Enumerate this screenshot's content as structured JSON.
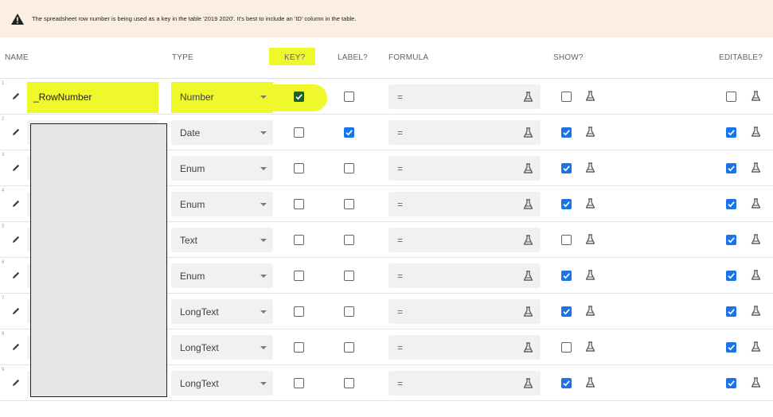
{
  "warning": {
    "icon": "warning-triangle-icon",
    "text": "The spreadsheet row number is being used as a key in the table '2019 2020'. It's best to include an 'ID' column in the table."
  },
  "header": {
    "name": "NAME",
    "type": "TYPE",
    "key": "KEY?",
    "label": "LABEL?",
    "formula": "FORMULA",
    "show": "SHOW?",
    "editable": "EDITABLE?"
  },
  "rows": [
    {
      "num": "1",
      "name": "_RowNumber",
      "type": "Number",
      "formula": "=",
      "key": true,
      "label": false,
      "show": false,
      "editable": false
    },
    {
      "num": "2",
      "name": "",
      "type": "Date",
      "formula": "=",
      "key": false,
      "label": true,
      "show": true,
      "editable": true
    },
    {
      "num": "3",
      "name": "",
      "type": "Enum",
      "formula": "=",
      "key": false,
      "label": false,
      "show": true,
      "editable": true
    },
    {
      "num": "4",
      "name": "",
      "type": "Enum",
      "formula": "=",
      "key": false,
      "label": false,
      "show": true,
      "editable": true
    },
    {
      "num": "5",
      "name": "",
      "type": "Text",
      "formula": "=",
      "key": false,
      "label": false,
      "show": false,
      "editable": true
    },
    {
      "num": "6",
      "name": "",
      "type": "Enum",
      "formula": "=",
      "key": false,
      "label": false,
      "show": true,
      "editable": true
    },
    {
      "num": "7",
      "name": "",
      "type": "LongText",
      "formula": "=",
      "key": false,
      "label": false,
      "show": true,
      "editable": true
    },
    {
      "num": "8",
      "name": "",
      "type": "LongText",
      "formula": "=",
      "key": false,
      "label": false,
      "show": false,
      "editable": true
    },
    {
      "num": "9",
      "name": "",
      "type": "LongText",
      "formula": "=",
      "key": false,
      "label": false,
      "show": true,
      "editable": true
    }
  ],
  "colors": {
    "checkbox_checked": "#1a73e8",
    "key_checked": "#17612c",
    "highlight": "#eef82a",
    "banner_bg": "#fbeee2"
  }
}
